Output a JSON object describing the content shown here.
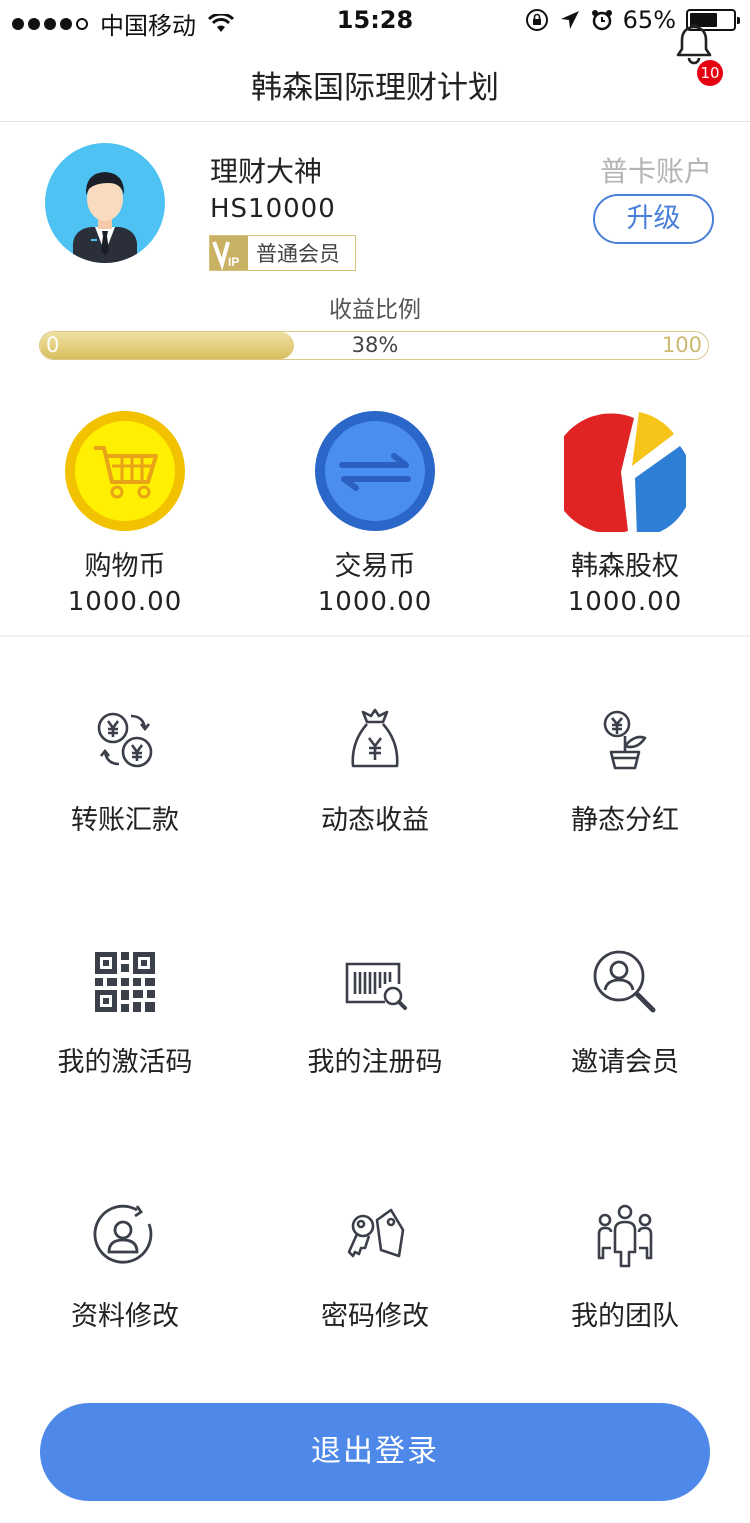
{
  "status_bar": {
    "carrier": "中国移动",
    "time": "15:28",
    "battery_percent": "65%",
    "battery_level": 0.65
  },
  "header": {
    "title": "韩森国际理财计划",
    "notification_count": "10"
  },
  "profile": {
    "name": "理财大神",
    "id": "HS10000",
    "member_level": "普通会员",
    "account_type": "普卡账户",
    "upgrade_label": "升级"
  },
  "earnings": {
    "title": "收益比例",
    "min": "0",
    "max": "100",
    "value_label": "38%",
    "value": 38
  },
  "wallets": [
    {
      "name": "购物币",
      "amount": "1000.00",
      "icon": "shopping-cart-icon",
      "color": "#f2c200"
    },
    {
      "name": "交易币",
      "amount": "1000.00",
      "icon": "exchange-arrows-icon",
      "color": "#2f74d9"
    },
    {
      "name": "韩森股权",
      "amount": "1000.00",
      "icon": "pie-chart-icon",
      "color": "#e02424"
    }
  ],
  "menu": [
    {
      "label": "转账汇款",
      "icon": "currency-exchange-icon"
    },
    {
      "label": "动态收益",
      "icon": "money-bag-icon"
    },
    {
      "label": "静态分红",
      "icon": "money-plant-icon"
    },
    {
      "label": "我的激活码",
      "icon": "qr-code-icon"
    },
    {
      "label": "我的注册码",
      "icon": "barcode-search-icon"
    },
    {
      "label": "邀请会员",
      "icon": "search-user-icon"
    },
    {
      "label": "资料修改",
      "icon": "user-refresh-icon"
    },
    {
      "label": "密码修改",
      "icon": "key-tag-icon"
    },
    {
      "label": "我的团队",
      "icon": "team-icon"
    }
  ],
  "logout_label": "退出登录"
}
